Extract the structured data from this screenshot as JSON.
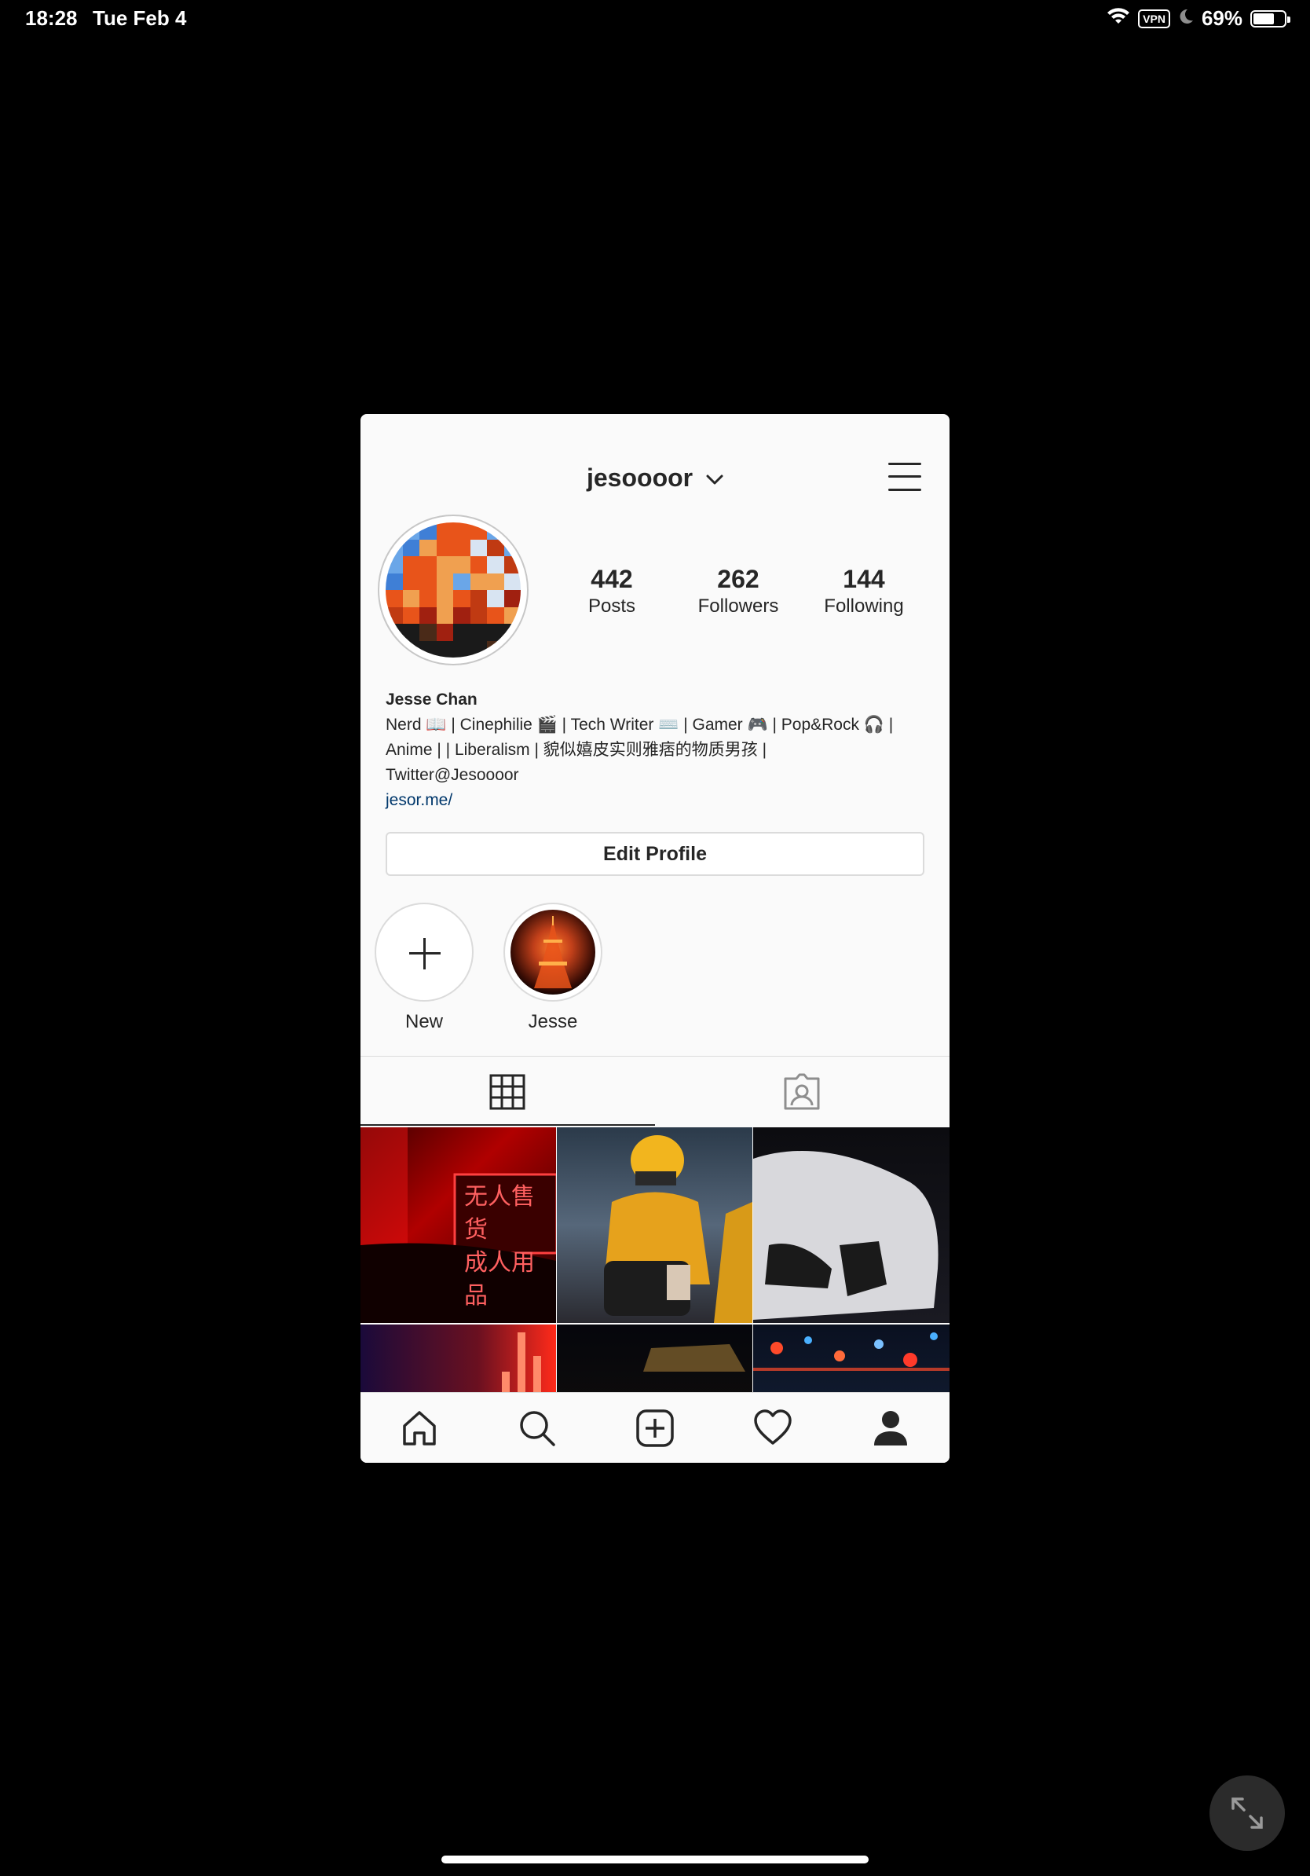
{
  "status_bar": {
    "time": "18:28",
    "date": "Tue Feb 4",
    "vpn_label": "VPN",
    "battery_percent": "69%",
    "battery_level": 0.69
  },
  "header": {
    "username": "jesoooor"
  },
  "stats": {
    "posts_count": "442",
    "posts_label": "Posts",
    "followers_count": "262",
    "followers_label": "Followers",
    "following_count": "144",
    "following_label": "Following"
  },
  "bio": {
    "name": "Jesse Chan",
    "line1": "Nerd 📖 | Cinephilie 🎬 | Tech Writer ⌨️ | Gamer 🎮 | Pop&Rock 🎧 |",
    "line2": "Anime |  | Liberalism | 貌似嬉皮实则雅痞的物质男孩 |",
    "line3": "Twitter@Jesoooor",
    "link": "jesor.me/"
  },
  "edit_profile_label": "Edit Profile",
  "highlights": [
    {
      "label": "New"
    },
    {
      "label": "Jesse"
    }
  ],
  "tiles": {
    "neon_sign_line1": "无人售货",
    "neon_sign_line2": "成人用品"
  },
  "colors": {
    "background": "#000000",
    "app_background": "#fafafa",
    "text": "#262626",
    "link": "#00376b",
    "border": "#dbdbdb"
  }
}
